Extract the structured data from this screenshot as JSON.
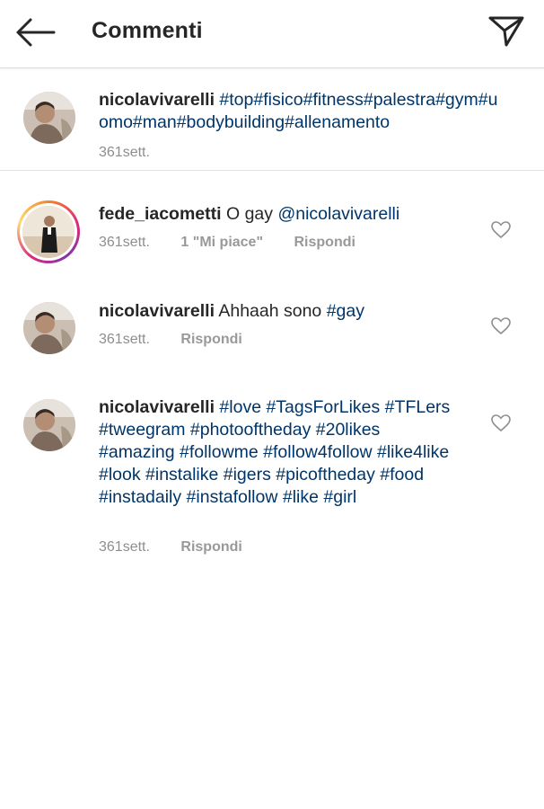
{
  "header": {
    "title": "Commenti",
    "back_icon": "arrow-left-icon",
    "send_icon": "direct-send-icon"
  },
  "caption": {
    "username": "nicolavivarelli",
    "text": "#top#fisico#fitness#palestra#gym#uomo#man#bodybuilding#allenamento",
    "time": "361sett."
  },
  "comments": [
    {
      "username": "fede_iacometti",
      "text_plain": "O gay ",
      "mention": "@nicolavivarelli",
      "time": "361sett.",
      "likes": "1 \"Mi piace\"",
      "reply": "Rispondi"
    },
    {
      "username": "nicolavivarelli",
      "text_plain": "Ahhaah sono ",
      "tag": "#gay",
      "time": "361sett.",
      "reply": "Rispondi"
    },
    {
      "username": "nicolavivarelli",
      "tags": "#love #TagsForLikes #TFLers #tweegram #photooftheday #20likes #amazing #followme #follow4follow #like4like #look #instalike #igers #picoftheday #food #instadaily #instafollow #like #girl",
      "time": "361sett.",
      "reply": "Rispondi"
    }
  ],
  "colors": {
    "link": "#003569",
    "meta": "#8e8e8e",
    "divider": "#dbdbdb"
  }
}
